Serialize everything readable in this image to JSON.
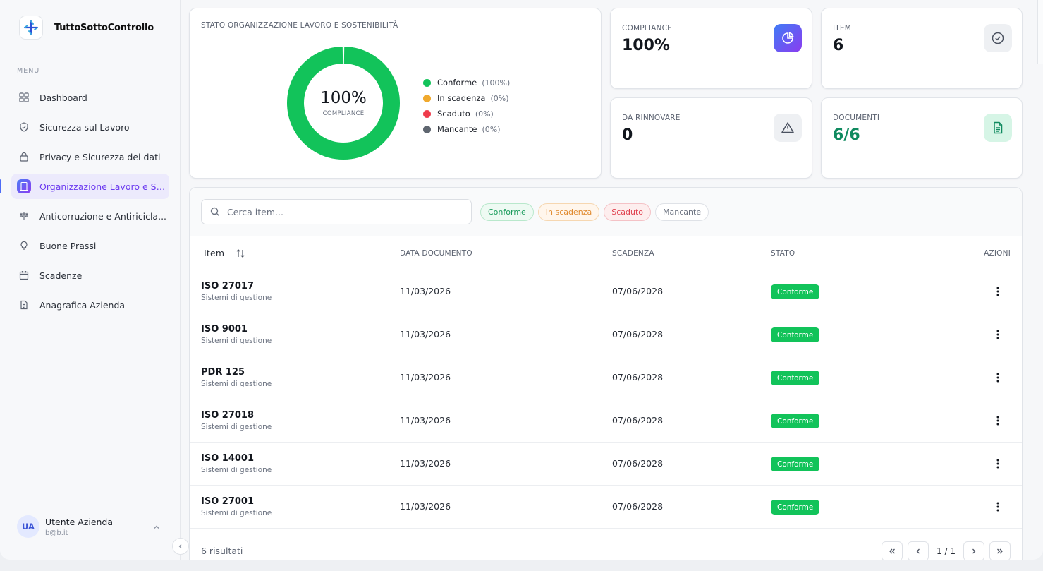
{
  "brand": {
    "name": "TuttoSottoControllo"
  },
  "sidebar": {
    "menu_label": "MENU",
    "items": [
      {
        "label": "Dashboard",
        "icon": "grid-icon"
      },
      {
        "label": "Sicurezza sul Lavoro",
        "icon": "shield-icon"
      },
      {
        "label": "Privacy e Sicurezza dei dati",
        "icon": "lock-icon"
      },
      {
        "label": "Organizzazione Lavoro e So...",
        "icon": "building-icon",
        "active": true
      },
      {
        "label": "Anticorruzione e Antiricicla...",
        "icon": "scale-icon"
      },
      {
        "label": "Buone Prassi",
        "icon": "lightbulb-icon"
      },
      {
        "label": "Scadenze",
        "icon": "calendar-icon"
      },
      {
        "label": "Anagrafica Azienda",
        "icon": "document-icon"
      }
    ]
  },
  "user": {
    "initials": "UA",
    "name": "Utente Azienda",
    "email": "b@b.it"
  },
  "status_card": {
    "title": "STATO ORGANIZZAZIONE LAVORO E SOSTENIBILITÀ",
    "center_value": "100%",
    "center_label": "COMPLIANCE",
    "legend": [
      {
        "label": "Conforme",
        "pct": "(100%)",
        "color": "#12c35a",
        "value": 100
      },
      {
        "label": "In scadenza",
        "pct": "(0%)",
        "color": "#f0a92e",
        "value": 0
      },
      {
        "label": "Scaduto",
        "pct": "(0%)",
        "color": "#ef3b4b",
        "value": 0
      },
      {
        "label": "Mancante",
        "pct": "(0%)",
        "color": "#5f6670",
        "value": 0
      }
    ]
  },
  "stats": {
    "compliance": {
      "title": "COMPLIANCE",
      "value": "100%"
    },
    "item": {
      "title": "ITEM",
      "value": "6"
    },
    "da_rinnovare": {
      "title": "DA RINNOVARE",
      "value": "0"
    },
    "documenti": {
      "title": "DOCUMENTI",
      "value": "6/6"
    }
  },
  "colors": {
    "accent": "#6d3cf0",
    "success": "#12c35a",
    "documents": "#0f8a5f"
  },
  "search": {
    "placeholder": "Cerca item..."
  },
  "filters": [
    {
      "label": "Conforme",
      "color": "#1a9c5c",
      "bg": "#eefaf3",
      "border": "#b9e8cc"
    },
    {
      "label": "In scadenza",
      "color": "#e08a2e",
      "bg": "#fff6ec",
      "border": "#f6d7b1"
    },
    {
      "label": "Scaduto",
      "color": "#e0414f",
      "bg": "#fdeeee",
      "border": "#f4c2c6"
    },
    {
      "label": "Mancante",
      "color": "#6b7280",
      "bg": "#ffffff",
      "border": "#dfe2e7"
    }
  ],
  "table": {
    "headers": {
      "item": "Item",
      "data_documento": "DATA DOCUMENTO",
      "scadenza": "SCADENZA",
      "stato": "STATO",
      "azioni": "AZIONI"
    },
    "rows": [
      {
        "name": "ISO 27017",
        "category": "Sistemi di gestione",
        "doc_date": "11/03/2026",
        "expiry": "07/06/2028",
        "status": "Conforme"
      },
      {
        "name": "ISO 9001",
        "category": "Sistemi di gestione",
        "doc_date": "11/03/2026",
        "expiry": "07/06/2028",
        "status": "Conforme"
      },
      {
        "name": "PDR 125",
        "category": "Sistemi di gestione",
        "doc_date": "11/03/2026",
        "expiry": "07/06/2028",
        "status": "Conforme"
      },
      {
        "name": "ISO 27018",
        "category": "Sistemi di gestione",
        "doc_date": "11/03/2026",
        "expiry": "07/06/2028",
        "status": "Conforme"
      },
      {
        "name": "ISO 14001",
        "category": "Sistemi di gestione",
        "doc_date": "11/03/2026",
        "expiry": "07/06/2028",
        "status": "Conforme"
      },
      {
        "name": "ISO 27001",
        "category": "Sistemi di gestione",
        "doc_date": "11/03/2026",
        "expiry": "07/06/2028",
        "status": "Conforme"
      }
    ]
  },
  "footer": {
    "results": "6 risultati",
    "page_info": "1 / 1"
  }
}
